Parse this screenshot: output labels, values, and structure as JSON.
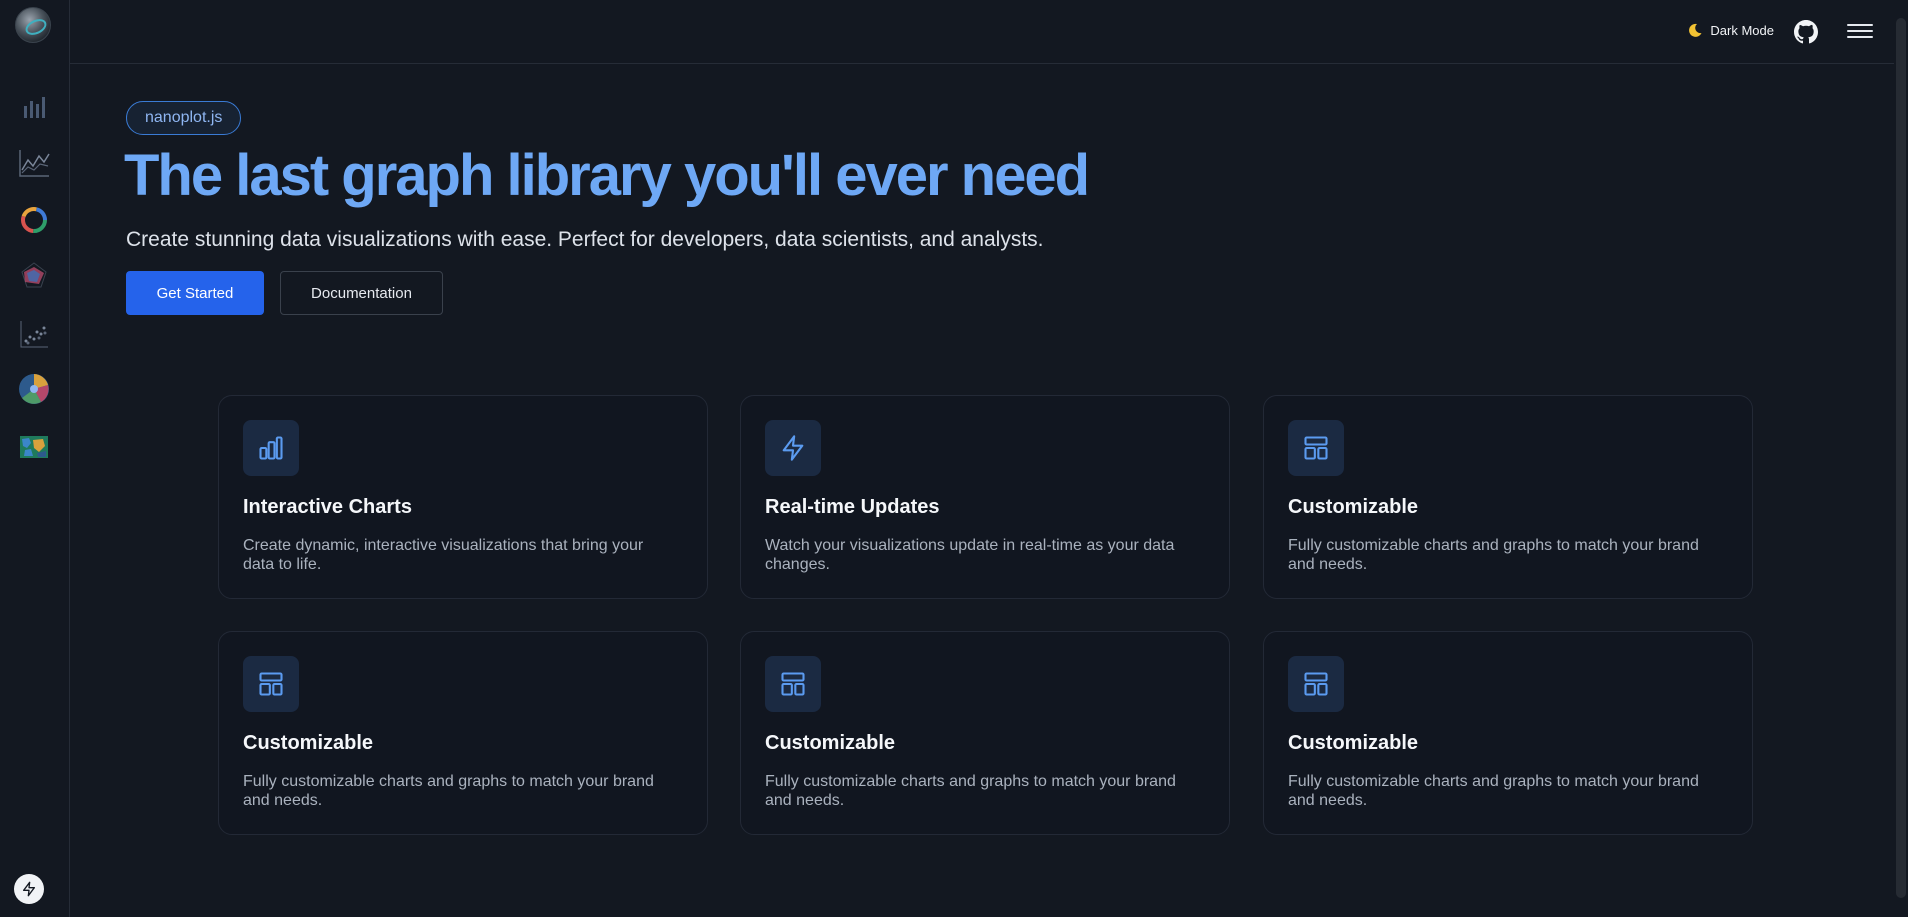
{
  "sidebar": {
    "items": [
      {
        "name": "bar-chart",
        "icon": "bar-chart-icon"
      },
      {
        "name": "line-chart",
        "icon": "line-chart-icon"
      },
      {
        "name": "donut-chart",
        "icon": "donut-chart-icon"
      },
      {
        "name": "radar-chart",
        "icon": "radar-chart-icon"
      },
      {
        "name": "scatter-chart",
        "icon": "scatter-chart-icon"
      },
      {
        "name": "polar-chart",
        "icon": "polar-chart-icon"
      },
      {
        "name": "map-chart",
        "icon": "map-chart-icon"
      }
    ],
    "bottom_icon": "lightning-icon"
  },
  "header": {
    "dark_mode_label": "Dark Mode",
    "dark_mode_icon": "moon-icon",
    "github_icon": "github-icon",
    "menu_icon": "hamburger-menu-icon"
  },
  "hero": {
    "badge": "nanoplot.js",
    "headline": "The last graph library you'll ever need",
    "subheadline": "Create stunning data visualizations with ease. Perfect for developers, data scientists, and analysts.",
    "primary_button": "Get Started",
    "secondary_button": "Documentation"
  },
  "features": [
    {
      "icon": "bar-chart-icon",
      "title": "Interactive Charts",
      "description": "Create dynamic, interactive visualizations that bring your data to life."
    },
    {
      "icon": "lightning-icon",
      "title": "Real-time Updates",
      "description": "Watch your visualizations update in real-time as your data changes."
    },
    {
      "icon": "layout-icon",
      "title": "Customizable",
      "description": "Fully customizable charts and graphs to match your brand and needs."
    },
    {
      "icon": "layout-icon",
      "title": "Customizable",
      "description": "Fully customizable charts and graphs to match your brand and needs."
    },
    {
      "icon": "layout-icon",
      "title": "Customizable",
      "description": "Fully customizable charts and graphs to match your brand and needs."
    },
    {
      "icon": "layout-icon",
      "title": "Customizable",
      "description": "Fully customizable charts and graphs to match your brand and needs."
    }
  ],
  "colors": {
    "background": "#131821",
    "accent": "#2563eb",
    "headline": "#6ea8f5",
    "card_icon_bg": "#1b2a42"
  }
}
